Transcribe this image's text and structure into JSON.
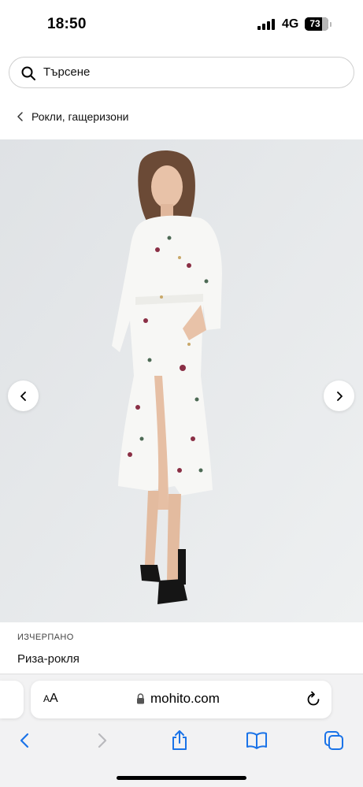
{
  "status_bar": {
    "time": "18:50",
    "network": "4G",
    "battery_percent": 73,
    "battery_label": "73"
  },
  "search": {
    "placeholder": "Търсене",
    "icon": "search-icon"
  },
  "breadcrumb": {
    "label": "Рокли, гащеризони",
    "icon": "chevron-left-icon"
  },
  "product": {
    "image": "product-photo",
    "stock_status": "ИЗЧЕРПАНО",
    "name": "Риза-рокля",
    "carousel_prev_icon": "chevron-left-icon",
    "carousel_next_icon": "chevron-right-icon"
  },
  "browser": {
    "aa_label_small": "A",
    "aa_label_large": "A",
    "url": "mohito.com",
    "lock_icon": "lock-icon",
    "reload_icon": "reload-icon",
    "toolbar": {
      "back_icon": "chevron-left-icon",
      "forward_icon": "chevron-right-icon",
      "share_icon": "share-icon",
      "bookmarks_icon": "book-icon",
      "tabs_icon": "tabs-icon",
      "accent_color": "#1a73e8",
      "disabled_color": "#b9b9bd"
    }
  }
}
